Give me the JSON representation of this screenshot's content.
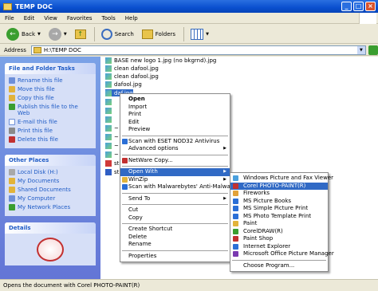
{
  "window": {
    "title": "TEMP DOC"
  },
  "menubar": {
    "items": [
      "File",
      "Edit",
      "View",
      "Favorites",
      "Tools",
      "Help"
    ]
  },
  "toolbar": {
    "back_label": "Back",
    "search_label": "Search",
    "folders_label": "Folders"
  },
  "address": {
    "label": "Address",
    "value": "H:\\TEMP DOC"
  },
  "sidebar": {
    "file_folder_tasks": {
      "title": "File and Folder Tasks",
      "items": [
        "Rename this file",
        "Move this file",
        "Copy this file",
        "Publish this file to the Web",
        "E-mail this file",
        "Print this file",
        "Delete this file"
      ]
    },
    "other_places": {
      "title": "Other Places",
      "items": [
        "Local Disk (H:)",
        "My Documents",
        "Shared Documents",
        "My Computer",
        "My Network Places"
      ]
    },
    "details": {
      "title": "Details"
    }
  },
  "files": [
    {
      "name": "BASE new logo 1.jpg (no bkgrnd).jpg",
      "type": "jpg"
    },
    {
      "name": "clean dafool.jpg",
      "type": "jpg"
    },
    {
      "name": "clean dafool.jpg",
      "type": "jpg"
    },
    {
      "name": "dafool.jpg",
      "type": "jpg"
    },
    {
      "name": "daf.jpg",
      "type": "jpg"
    },
    {
      "name": "",
      "type": "jpg"
    },
    {
      "name": "",
      "type": "jpg"
    },
    {
      "name": "",
      "type": "jpg"
    },
    {
      "name": "~",
      "type": "jpg"
    },
    {
      "name": "~",
      "type": "jpg"
    },
    {
      "name": "~",
      "type": "jpg"
    },
    {
      "name": "~",
      "type": "jpg"
    },
    {
      "name": "st",
      "type": "pdf"
    },
    {
      "name": "st",
      "type": "doc"
    }
  ],
  "context_menu": {
    "items": [
      {
        "label": "Open",
        "bold": true
      },
      {
        "label": "Import"
      },
      {
        "label": "Print"
      },
      {
        "label": "Edit"
      },
      {
        "label": "Preview"
      },
      {
        "sep": true
      },
      {
        "label": "Scan with ESET NOD32 Antivirus",
        "icon": "#2b6fd6"
      },
      {
        "label": "Advanced options",
        "submenu": true
      },
      {
        "sep": true
      },
      {
        "label": "NetWare Copy...",
        "icon": "#c23030"
      },
      {
        "sep": true
      },
      {
        "label": "Open With",
        "submenu": true,
        "highlighted": true
      },
      {
        "label": "WinZip",
        "submenu": true,
        "icon": "#e2b33a"
      },
      {
        "label": "Scan with Malwarebytes' Anti-Malware",
        "icon": "#2b6fd6"
      },
      {
        "sep": true
      },
      {
        "label": "Send To",
        "submenu": true
      },
      {
        "sep": true
      },
      {
        "label": "Cut"
      },
      {
        "label": "Copy"
      },
      {
        "sep": true
      },
      {
        "label": "Create Shortcut"
      },
      {
        "label": "Delete"
      },
      {
        "label": "Rename"
      },
      {
        "sep": true
      },
      {
        "label": "Properties"
      }
    ]
  },
  "open_with_menu": {
    "items": [
      {
        "label": "Windows Picture and Fax Viewer",
        "icon": "#4aa0dd"
      },
      {
        "label": "Corel PHOTO-PAINT(R)",
        "icon": "#c23030",
        "highlighted": true
      },
      {
        "label": "Fireworks",
        "icon": "#e2a23a"
      },
      {
        "label": "MS Picture Books",
        "icon": "#2b6fd6"
      },
      {
        "label": "MS Simple Picture Print",
        "icon": "#2b6fd6"
      },
      {
        "label": "MS Photo Template Print",
        "icon": "#2b6fd6"
      },
      {
        "label": "Paint",
        "icon": "#e2b33a"
      },
      {
        "label": "CorelDRAW(R)",
        "icon": "#3a9e2f"
      },
      {
        "label": "Paint Shop",
        "icon": "#c23030"
      },
      {
        "label": "Internet Explorer",
        "icon": "#2b6fd6"
      },
      {
        "label": "Microsoft Office Picture Manager",
        "icon": "#7a3ab0"
      },
      {
        "sep": true
      },
      {
        "label": "Choose Program..."
      }
    ]
  },
  "status": {
    "text": "Opens the document with Corel PHOTO-PAINT(R)"
  }
}
